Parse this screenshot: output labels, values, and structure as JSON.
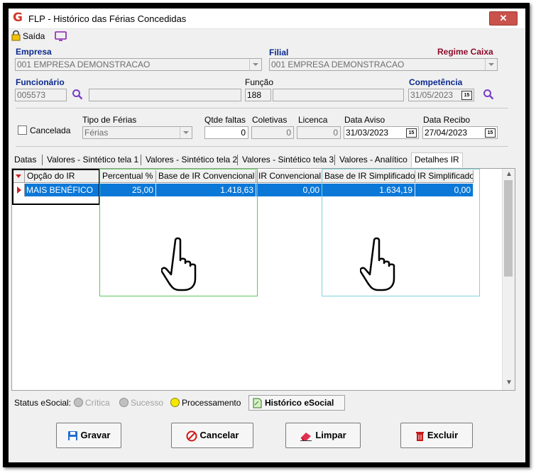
{
  "window": {
    "title": "FLP - Histórico das Férias Concedidas",
    "close_label": "✕"
  },
  "toolbar": {
    "saida_label": "Saída"
  },
  "form": {
    "empresa_label": "Empresa",
    "empresa_value": "001 EMPRESA DEMONSTRACAO",
    "filial_label": "Filial",
    "filial_value": "001 EMPRESA DEMONSTRACAO",
    "regime_label": "Regime Caixa",
    "funcionario_label": "Funcionário",
    "funcionario_code": "005573",
    "funcionario_name": "",
    "funcao_label": "Função",
    "funcao_code": "188",
    "funcao_name": "",
    "competencia_label": "Competência",
    "competencia_value": "31/05/2023",
    "cancelada_label": "Cancelada",
    "tipo_ferias_label": "Tipo de Férias",
    "tipo_ferias_value": "Férias",
    "qtde_faltas_label": "Qtde faltas",
    "qtde_faltas_value": "0",
    "coletivas_label": "Coletivas",
    "coletivas_value": "0",
    "licenca_label": "Licenca",
    "licenca_value": "0",
    "data_aviso_label": "Data Aviso",
    "data_aviso_value": "31/03/2023",
    "data_recibo_label": "Data Recibo",
    "data_recibo_value": "27/04/2023",
    "cal_glyph": "15"
  },
  "tabs": [
    {
      "label": "Datas"
    },
    {
      "label": "Valores - Sintético tela 1"
    },
    {
      "label": "Valores - Sintético tela 2"
    },
    {
      "label": "Valores - Sintético tela 3"
    },
    {
      "label": "Valores - Analítico"
    },
    {
      "label": "Detalhes IR"
    }
  ],
  "grid": {
    "columns": [
      "Opção do IR",
      "Percentual %",
      "Base de IR Convencional",
      "IR Convencional",
      "Base de IR Simplificado",
      "IR Simplificado"
    ],
    "rows": [
      [
        "MAIS BENÉFICO",
        "25,00",
        "1.418,63",
        "0,00",
        "1.634,19",
        "0,00"
      ]
    ],
    "highlight_colors": {
      "box1": "#000000",
      "box2": "#5cc85c",
      "box3": "#7fd4dc"
    }
  },
  "status": {
    "label": "Status eSocial:",
    "options": [
      "Crítica",
      "Sucesso",
      "Processamento"
    ],
    "historico_label": "Histórico eSocial"
  },
  "buttons": {
    "gravar": "Gravar",
    "cancelar": "Cancelar",
    "limpar": "Limpar",
    "excluir": "Excluir"
  }
}
